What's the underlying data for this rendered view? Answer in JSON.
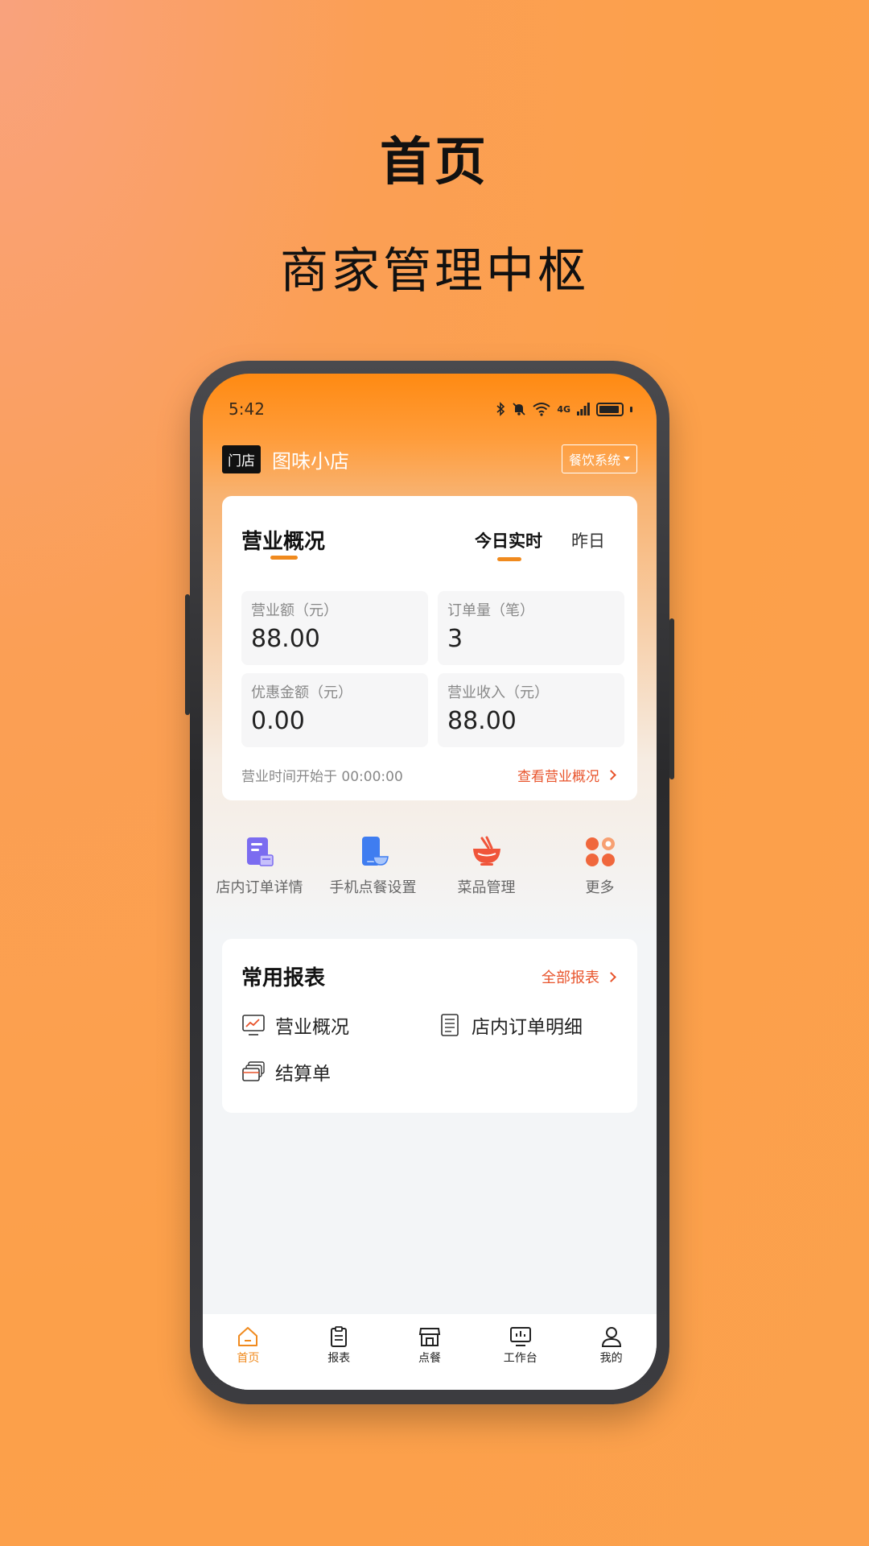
{
  "promo": {
    "title": "首页",
    "subtitle": "商家管理中枢"
  },
  "status_bar": {
    "time": "5:42",
    "network": "4G"
  },
  "store": {
    "tag": "门店",
    "name": "图味小店",
    "system_select": "餐饮系统"
  },
  "overview": {
    "title": "营业概况",
    "tabs": [
      {
        "label": "今日实时",
        "active": true
      },
      {
        "label": "昨日",
        "active": false
      }
    ],
    "metrics": [
      {
        "label": "营业额（元）",
        "value": "88.00"
      },
      {
        "label": "订单量（笔）",
        "value": "3"
      },
      {
        "label": "优惠金额（元）",
        "value": "0.00"
      },
      {
        "label": "营业收入（元）",
        "value": "88.00"
      }
    ],
    "start_time": "营业时间开始于 00:00:00",
    "view_link": "查看营业概况"
  },
  "quick_actions": [
    {
      "label": "店内订单详情",
      "icon": "order-detail-icon"
    },
    {
      "label": "手机点餐设置",
      "icon": "phone-order-icon"
    },
    {
      "label": "菜品管理",
      "icon": "dish-bowl-icon"
    },
    {
      "label": "更多",
      "icon": "more-grid-icon"
    }
  ],
  "reports": {
    "title": "常用报表",
    "all_link": "全部报表",
    "items": [
      {
        "label": "营业概况",
        "icon": "monitor-chart-icon"
      },
      {
        "label": "店内订单明细",
        "icon": "document-list-icon"
      },
      {
        "label": "结算单",
        "icon": "cards-stack-icon"
      }
    ]
  },
  "tabbar": [
    {
      "label": "首页",
      "icon": "home-icon",
      "active": true
    },
    {
      "label": "报表",
      "icon": "clipboard-icon",
      "active": false
    },
    {
      "label": "点餐",
      "icon": "storefront-icon",
      "active": false
    },
    {
      "label": "工作台",
      "icon": "monitor-icon",
      "active": false
    },
    {
      "label": "我的",
      "icon": "user-icon",
      "active": false
    }
  ],
  "colors": {
    "accent": "#f08a1e",
    "link": "#e8542c",
    "header": "#ff8a12"
  }
}
